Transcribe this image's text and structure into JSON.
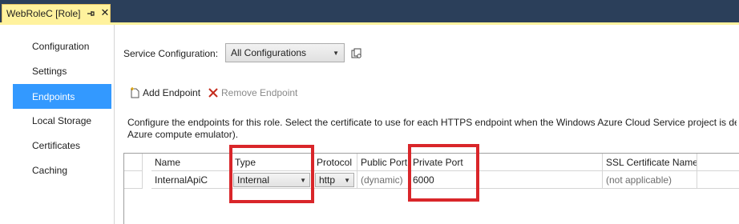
{
  "tab": {
    "title": "WebRoleC [Role]",
    "pin_icon": "pin-icon",
    "close_glyph": "✕"
  },
  "sidebar": {
    "items": [
      {
        "label": "Configuration"
      },
      {
        "label": "Settings"
      },
      {
        "label": "Endpoints",
        "selected": true
      },
      {
        "label": "Local Storage"
      },
      {
        "label": "Certificates"
      },
      {
        "label": "Caching"
      }
    ]
  },
  "service_config": {
    "label": "Service Configuration:",
    "value": "All Configurations"
  },
  "toolbar": {
    "add_label": "Add Endpoint",
    "remove_label": "Remove Endpoint"
  },
  "description": {
    "line1": "Configure the endpoints for this role.  Select the certificate to use for each HTTPS endpoint when the Windows Azure Cloud Service project is deployed (including the",
    "line2": "Azure compute emulator)."
  },
  "grid": {
    "columns": [
      "Name",
      "Type",
      "Protocol",
      "Public Port",
      "Private Port",
      "SSL Certificate Name"
    ],
    "rows": [
      {
        "name": "InternalApiC",
        "type": "Internal",
        "protocol": "http",
        "public_port": "(dynamic)",
        "private_port": "6000",
        "ssl_certificate": "(not applicable)"
      }
    ]
  },
  "colors": {
    "selected_bg": "#3399ff",
    "tab_bg": "#fff29d",
    "highlight": "#d9262a"
  }
}
